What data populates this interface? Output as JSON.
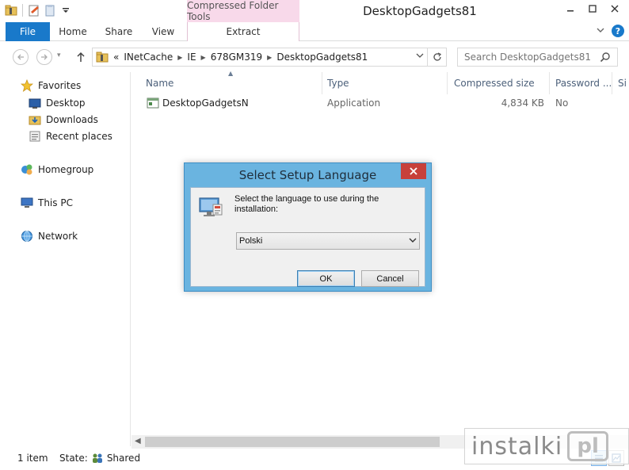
{
  "window": {
    "title": "DesktopGadgets81",
    "context_tab_group": "Compressed Folder Tools"
  },
  "ribbon": {
    "tabs": [
      {
        "label": "File"
      },
      {
        "label": "Home"
      },
      {
        "label": "Share"
      },
      {
        "label": "View"
      },
      {
        "label": "Extract"
      }
    ]
  },
  "address": {
    "overflow": "«",
    "segments": [
      "INetCache",
      "IE",
      "678GM319",
      "DesktopGadgets81"
    ]
  },
  "search": {
    "placeholder": "Search DesktopGadgets81"
  },
  "navpane": {
    "favorites": "Favorites",
    "desktop": "Desktop",
    "downloads": "Downloads",
    "recent": "Recent places",
    "homegroup": "Homegroup",
    "thispc": "This PC",
    "network": "Network"
  },
  "filelist": {
    "columns": [
      "Name",
      "Type",
      "Compressed size",
      "Password ...",
      "Si"
    ],
    "rows": [
      {
        "name": "DesktopGadgetsN",
        "type": "Application",
        "compressed_size": "4,834 KB",
        "password": "No"
      }
    ]
  },
  "statusbar": {
    "count": "1 item",
    "state_label": "State:",
    "state_value": "Shared"
  },
  "watermark": {
    "text": "instalki",
    "suffix": "pl"
  },
  "dialog": {
    "title": "Select Setup Language",
    "message": "Select the language to use during the installation:",
    "selected_language": "Polski",
    "ok_label": "OK",
    "cancel_label": "Cancel"
  }
}
